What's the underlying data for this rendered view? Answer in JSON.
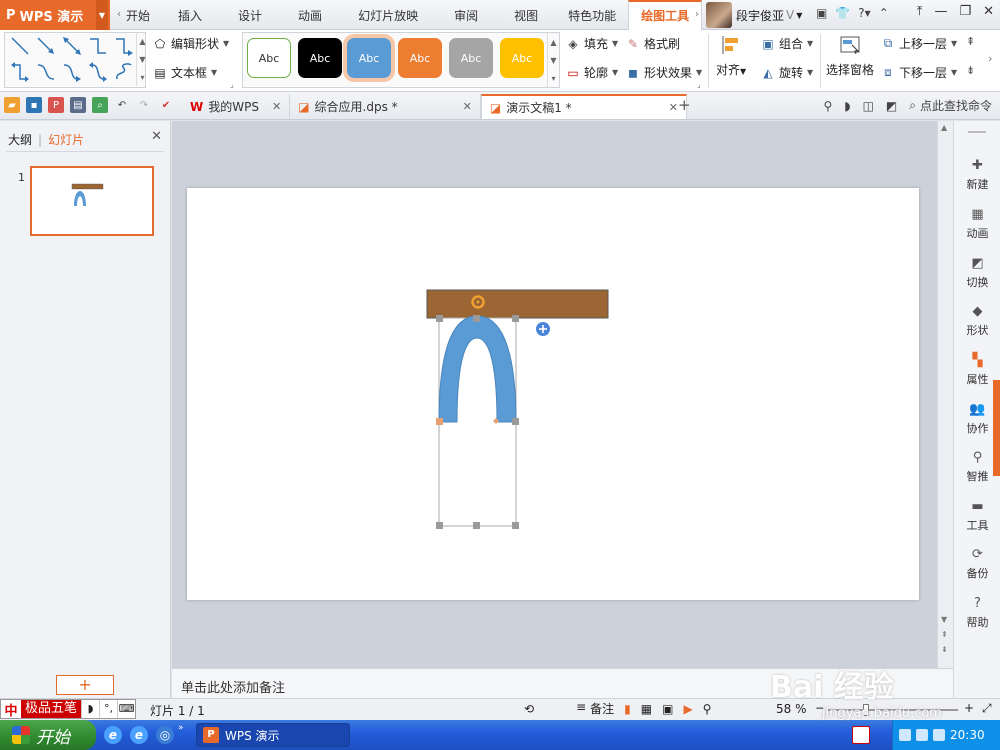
{
  "app": {
    "logo": "WPS 演示",
    "menu_tabs": [
      {
        "label": "开始"
      },
      {
        "label": "插入"
      },
      {
        "label": "设计"
      },
      {
        "label": "动画"
      },
      {
        "label": "幻灯片放映"
      },
      {
        "label": "审阅"
      },
      {
        "label": "视图"
      },
      {
        "label": "特色功能"
      },
      {
        "label": "绘图工具"
      }
    ],
    "user_name": "段宇俊亚",
    "user_badge": "V"
  },
  "ribbon": {
    "edit_shape": "编辑形状",
    "text_box": "文本框",
    "style_label": "Abc",
    "styles": [
      {
        "bg": "#ffffff",
        "border": "#70ad47",
        "text": "#333333"
      },
      {
        "bg": "#000000",
        "border": "#000000",
        "text": "#ffffff"
      },
      {
        "bg": "#5b9bd5",
        "border": "#5b9bd5",
        "text": "#ffffff"
      },
      {
        "bg": "#ed7d31",
        "border": "#ed7d31",
        "text": "#ffffff"
      },
      {
        "bg": "#a5a5a5",
        "border": "#a5a5a5",
        "text": "#ffffff"
      },
      {
        "bg": "#ffc000",
        "border": "#ffc000",
        "text": "#ffffff"
      }
    ],
    "fill": "填充",
    "format_painter": "格式刷",
    "outline": "轮廓",
    "shape_effect": "形状效果",
    "align": "对齐",
    "group": "组合",
    "rotate": "旋转",
    "selection_pane": "选择窗格",
    "bring_forward": "上移一层",
    "send_backward": "下移一层"
  },
  "doc_tabs": [
    {
      "label": "我的WPS",
      "active": false
    },
    {
      "label": "综合应用.dps *",
      "active": false
    },
    {
      "label": "演示文稿1 *",
      "active": true
    }
  ],
  "search_label": "点此查找命令",
  "left_panel": {
    "outline_tab": "大纲",
    "slides_tab": "幻灯片",
    "slide_number": "1",
    "add_label": "+"
  },
  "notes_placeholder": "单击此处添加备注",
  "right_bar": [
    {
      "label": "新建",
      "icon": "new-icon"
    },
    {
      "label": "动画",
      "icon": "animation-icon"
    },
    {
      "label": "切换",
      "icon": "transition-icon"
    },
    {
      "label": "形状",
      "icon": "shape-icon"
    },
    {
      "label": "属性",
      "icon": "property-icon"
    },
    {
      "label": "协作",
      "icon": "collaborate-icon"
    },
    {
      "label": "智推",
      "icon": "smart-icon"
    },
    {
      "label": "工具",
      "icon": "tool-icon"
    },
    {
      "label": "备份",
      "icon": "backup-icon"
    },
    {
      "label": "帮助",
      "icon": "help-icon"
    }
  ],
  "status": {
    "ime_name": "极品五笔",
    "slide_status": "灯片 1 / 1",
    "notes_btn": "备注",
    "zoom": "58 %"
  },
  "taskbar": {
    "start": "开始",
    "task_item": "WPS 演示",
    "clock": "20:30"
  },
  "watermark": {
    "main": "Bai 经验",
    "sub": "jingyan.baidu.com"
  },
  "colors": {
    "accent": "#e86a2a",
    "bar_brown": "#9b6633",
    "arch_blue": "#5b9bd5"
  }
}
